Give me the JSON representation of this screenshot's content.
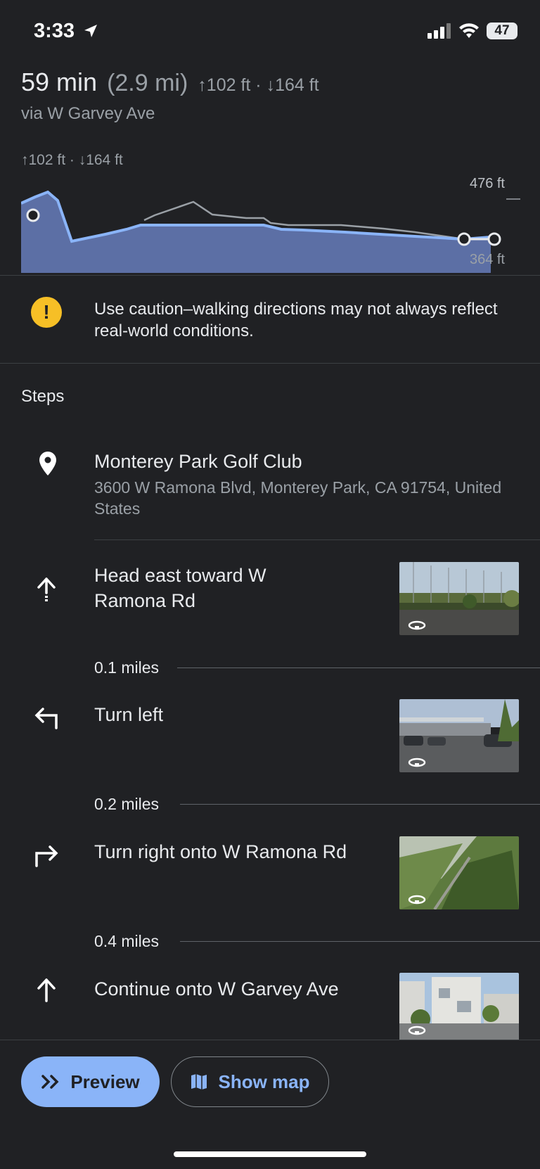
{
  "status_bar": {
    "time": "3:33",
    "battery": "47"
  },
  "route": {
    "duration": "59 min",
    "distance": "(2.9 mi)",
    "elevation": "↑102 ft · ↓164 ft",
    "via": "via W Garvey Ave"
  },
  "elevation_chart": {
    "summary": "↑102 ft · ↓164 ft",
    "max_label": "476 ft",
    "min_label": "364 ft"
  },
  "caution": {
    "icon": "exclamation",
    "text": "Use caution–walking directions may not always reflect real-world conditions."
  },
  "steps_title": "Steps",
  "destination": {
    "name": "Monterey Park Golf Club",
    "address": "3600 W Ramona Blvd, Monterey Park, CA 91754, United States"
  },
  "steps": [
    {
      "icon": "straight-arrow-icon",
      "text": "Head east toward W Ramona Rd",
      "distance": "0.1 miles"
    },
    {
      "icon": "turn-left-icon",
      "text": "Turn left",
      "distance": "0.2 miles"
    },
    {
      "icon": "turn-right-icon",
      "text": "Turn right onto W Ramona Rd",
      "distance": "0.4 miles"
    },
    {
      "icon": "straight-arrow-icon",
      "text": "Continue onto W Garvey Ave"
    }
  ],
  "buttons": {
    "preview": "Preview",
    "show_map": "Show map"
  },
  "colors": {
    "accent": "#8ab4f8",
    "background": "#202124",
    "caution": "#f6bf26"
  }
}
